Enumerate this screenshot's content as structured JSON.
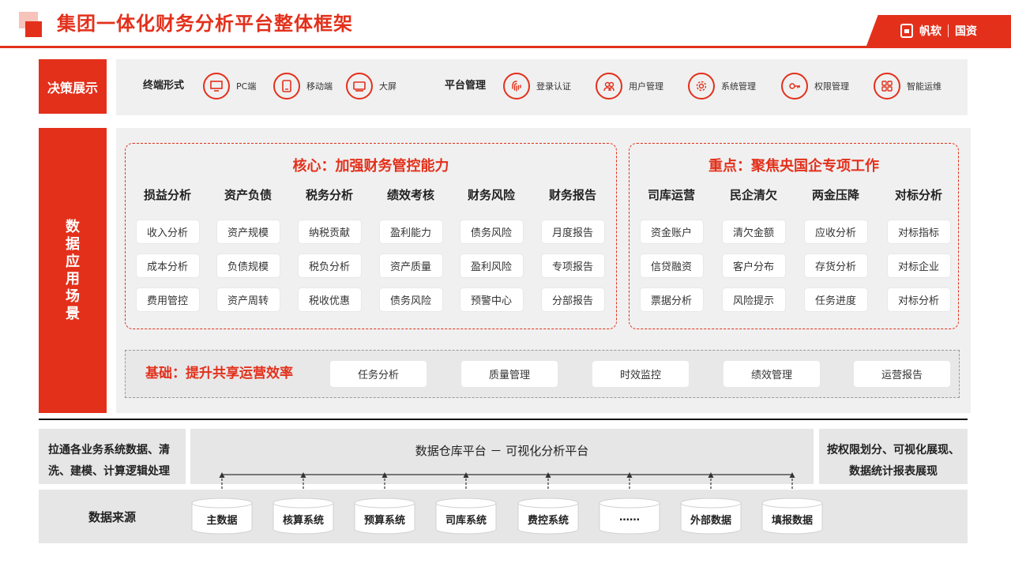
{
  "title": "集团一体化财务分析平台整体框架",
  "brand": {
    "name": "帆软",
    "suffix": "国资"
  },
  "colors": {
    "accent": "#e3301b",
    "panel": "#f0f0f0",
    "gray": "#e6e6e6"
  },
  "decision": {
    "label": "决策展示",
    "terminal": {
      "heading": "终端形式",
      "items": [
        {
          "label": "PC端",
          "icon": "monitor-icon"
        },
        {
          "label": "移动端",
          "icon": "tablet-icon"
        },
        {
          "label": "大屏",
          "icon": "screen-icon"
        }
      ]
    },
    "platform": {
      "heading": "平台管理",
      "items": [
        {
          "label": "登录认证",
          "icon": "fingerprint-icon"
        },
        {
          "label": "用户管理",
          "icon": "users-icon"
        },
        {
          "label": "系统管理",
          "icon": "gear-icon"
        },
        {
          "label": "权限管理",
          "icon": "key-icon"
        },
        {
          "label": "智能运维",
          "icon": "grid-icon"
        }
      ]
    }
  },
  "application": {
    "label": [
      "数",
      "据",
      "应",
      "用",
      "场",
      "景"
    ],
    "core": {
      "title": "核心：加强财务管控能力",
      "columns": [
        {
          "head": "损益分析",
          "items": [
            "收入分析",
            "成本分析",
            "费用管控"
          ]
        },
        {
          "head": "资产负债",
          "items": [
            "资产规模",
            "负债规模",
            "资产周转"
          ]
        },
        {
          "head": "税务分析",
          "items": [
            "纳税贡献",
            "税负分析",
            "税收优惠"
          ]
        },
        {
          "head": "绩效考核",
          "items": [
            "盈利能力",
            "资产质量",
            "债务风险"
          ]
        },
        {
          "head": "财务风险",
          "items": [
            "债务风险",
            "盈利风险",
            "预警中心"
          ]
        },
        {
          "head": "财务报告",
          "items": [
            "月度报告",
            "专项报告",
            "分部报告"
          ]
        }
      ]
    },
    "focus": {
      "title": "重点：聚焦央国企专项工作",
      "columns": [
        {
          "head": "司库运营",
          "items": [
            "资金账户",
            "信贷融资",
            "票据分析"
          ]
        },
        {
          "head": "民企清欠",
          "items": [
            "清欠金额",
            "客户分布",
            "风险提示"
          ]
        },
        {
          "head": "两金压降",
          "items": [
            "应收分析",
            "存货分析",
            "任务进度"
          ]
        },
        {
          "head": "对标分析",
          "items": [
            "对标指标",
            "对标企业",
            "对标分析"
          ]
        }
      ]
    },
    "base": {
      "title": "基础：提升共享运营效率",
      "items": [
        "任务分析",
        "质量管理",
        "时效监控",
        "绩效管理",
        "运营报告"
      ]
    }
  },
  "bottom": {
    "left": [
      "拉通各业务系统数据、清",
      "洗、建模、计算逻辑处理"
    ],
    "middle": "数据仓库平台 － 可视化分析平台",
    "right": [
      "按权限划分、可视化展现、",
      "数据统计报表展现"
    ],
    "sources_title": "数据来源",
    "sources": [
      "主数据",
      "核算系统",
      "预算系统",
      "司库系统",
      "费控系统",
      "……",
      "外部数据",
      "填报数据"
    ]
  }
}
